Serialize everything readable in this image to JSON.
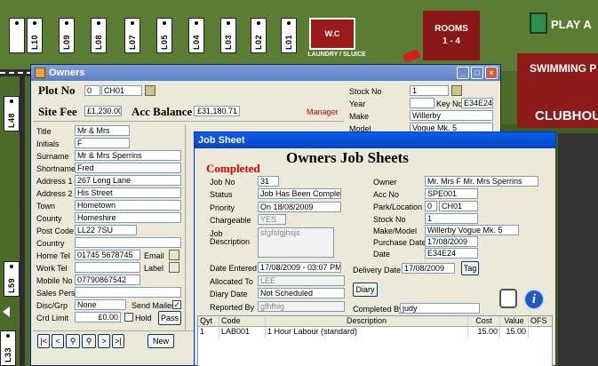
{
  "map": {
    "plots_top": [
      "L10",
      "L09",
      "L08",
      "L07",
      "L05",
      "L04",
      "L03",
      "L02",
      "L01"
    ],
    "plot_left_mid": "L48",
    "plot_left_low": "L59",
    "plot_left_bottom": "L33",
    "wc_label": "W.C",
    "laundry_label": "LAUNDRY / SLUICE",
    "rooms_label_1": "ROOMS",
    "rooms_label_2": "1 - 4",
    "pool_label": "SWIMMING P",
    "clubhouse_label": "CLUBHOU",
    "play_label": "PLAY A"
  },
  "owners": {
    "title": "Owners",
    "plot_no_label": "Plot No",
    "plot_no_value": "0",
    "plot_code": "CH01",
    "site_fee_label": "Site Fee",
    "site_fee_value": "£1,230.00",
    "acc_balance_label": "Acc Balance",
    "acc_balance_value": "£31,180.71",
    "manager_label": "Manager",
    "fields": {
      "title_label": "Title",
      "title_value": "Mr & Mrs",
      "initials_label": "Initials",
      "initials_value": "F",
      "surname_label": "Surname",
      "surname_value": "Mr & Mrs Sperrins",
      "shortname_label": "Shortname",
      "shortname_value": "Fred",
      "address1_label": "Address 1",
      "address1_value": "267 Long Lane",
      "address2_label": "Address 2",
      "address2_value": "His Street",
      "town_label": "Town",
      "town_value": "Hometown",
      "county_label": "County",
      "county_value": "Homeshire",
      "postcode_label": "Post Code",
      "postcode_value": "LL22 7SU",
      "country_label": "Country",
      "country_value": "",
      "hometel_label": "Home Tel",
      "hometel_value": "01745 5678745",
      "worktel_label": "Work Tel",
      "worktel_value": "",
      "mobile_label": "Mobile No",
      "mobile_value": "07790867542",
      "salespers_label": "Sales Pers",
      "salespers_value": "",
      "discgrp_label": "Disc/Grp",
      "discgrp_value": "None",
      "crdlimit_label": "Crd Limit",
      "crdlimit_value": "£0.00"
    },
    "email_label": "Email",
    "label_label": "Label",
    "send_mailer_label": "Send Mailer",
    "hold_label": "Hold",
    "pass_label": "Pass",
    "new_label": "New",
    "stock_no_label": "Stock No",
    "stock_no_value": "1",
    "year_label": "Year",
    "key_no_label": "Key No",
    "key_no_value": "E34E24",
    "make_label": "Make",
    "make_value": "Willerby",
    "model_label": "Model",
    "model_value": "Vogue Mk. 5"
  },
  "job": {
    "window_title": "Job Sheet",
    "heading": "Owners Job Sheets",
    "status_heading": "Completed",
    "job_no_label": "Job No",
    "job_no_value": "31",
    "status_label": "Status",
    "status_value": "Job Has Been Completed",
    "priority_label": "Priority",
    "priority_value": "On 18/08/2009",
    "chargeable_label": "Chargeable",
    "chargeable_value": "YES",
    "job_desc_label_1": "Job",
    "job_desc_label_2": "Description",
    "job_desc_value": "sfgfsfgjhsjs",
    "date_entered_label": "Date Entered",
    "date_entered_value": "17/08/2009 - 03:07 PM",
    "allocated_label": "Allocated To",
    "allocated_value": "LEE",
    "diary_date_label": "Diary Date",
    "diary_date_value": "Not Scheduled",
    "reported_by_label": "Reported By",
    "reported_by_value": "gfhfhlg",
    "owner_label": "Owner",
    "owner_value": "Mr. Mrs F Mr. Mrs Sperrins",
    "acc_no_label": "Acc No",
    "acc_no_value": "SPE001",
    "park_label": "Park/Location",
    "park_num": "0",
    "park_code": "CH01",
    "stock_label": "Stock No",
    "stock_value": "1",
    "makemodel_label": "Make/Model",
    "makemodel_value": "Willerby  Vogue Mk. 5",
    "purchase_label": "Purchase Date",
    "purchase_value": "17/08/2009",
    "date_label": "Date",
    "date_value": "E34E24",
    "delivery_label": "Delivery Date",
    "delivery_value": "17/08/2009",
    "tag_label": "Tag",
    "diary_button": "Diary",
    "completed_by_label": "Completed By",
    "completed_by_value": "judy",
    "columns": [
      "Qyt",
      "Code",
      "Description",
      "Cost",
      "Value",
      "OFS"
    ],
    "rows": [
      [
        "1",
        "LAB001",
        "1 Hour Labour (standard)",
        "15.00",
        "15.00",
        ""
      ]
    ]
  }
}
